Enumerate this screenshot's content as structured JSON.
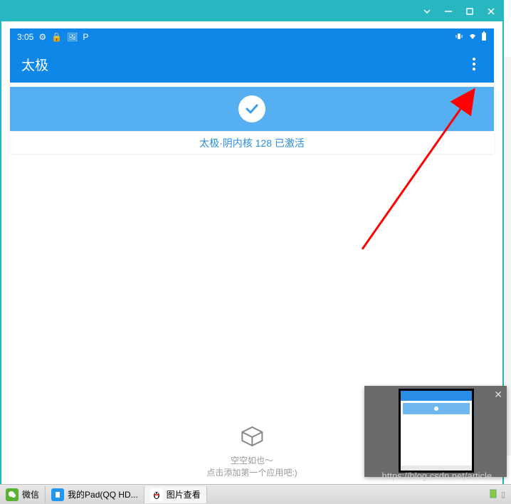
{
  "android_status": {
    "time": "3:05",
    "left_icons": [
      "⚙",
      "🔒",
      "🖼",
      "P"
    ]
  },
  "app": {
    "title": "太极",
    "status_text": "太极·阴内核 128 已激活"
  },
  "empty_state": {
    "line1": "空空如也～",
    "line2": "点击添加第一个应用吧:)"
  },
  "taskbar": {
    "items": [
      {
        "label": "微信"
      },
      {
        "label": "我的Pad(QQ HD..."
      },
      {
        "label": "图片查看"
      }
    ]
  },
  "watermark": "https://blog.csdn.net/article..."
}
